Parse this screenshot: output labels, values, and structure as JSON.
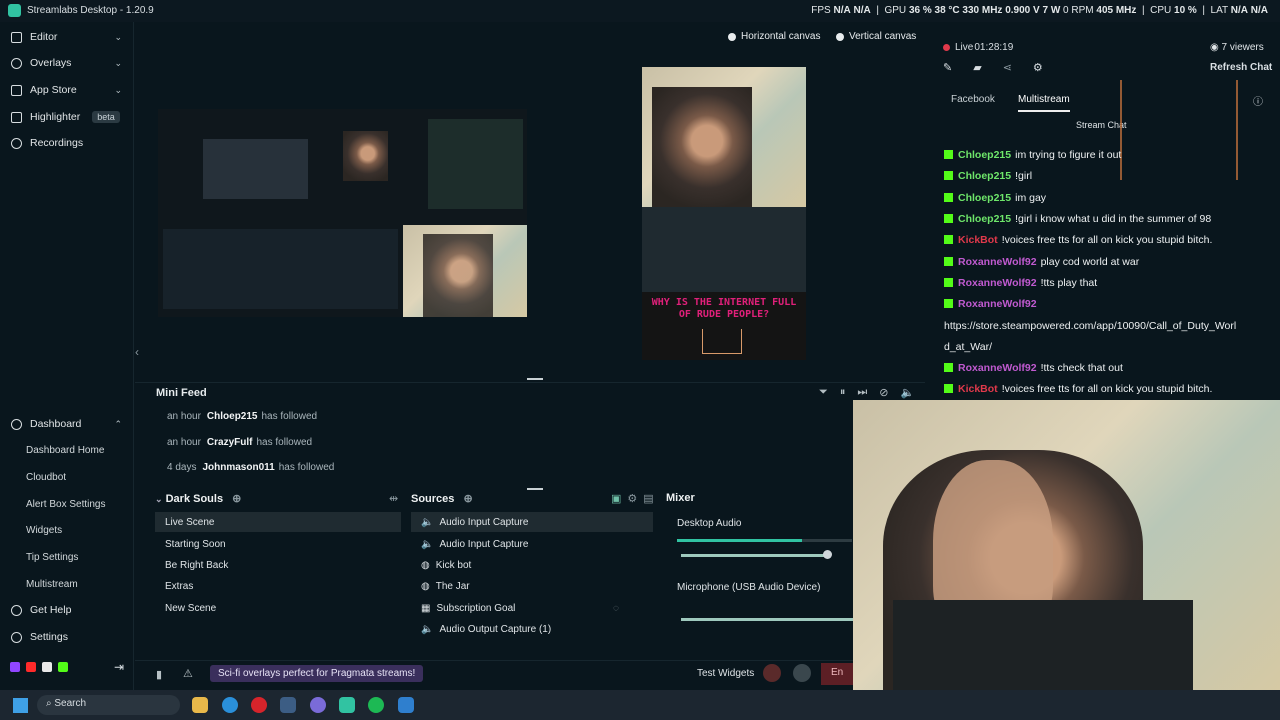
{
  "titlebar": {
    "title": "Streamlabs Desktop - 1.20.9",
    "fps_label": "FPS",
    "fps_value": "N/A",
    "fps_value2": "N/A",
    "gpu_label": "GPU",
    "gpu_usage": "36 %",
    "gpu_temp": "38 °C",
    "gpu_clock": "330 MHz",
    "gpu_volt": "0.900 V",
    "gpu_power": "7 W",
    "mem_clock_label": "0 RPM",
    "mem_clock": "405 MHz",
    "cpu_label": "CPU",
    "cpu_value": "10 %",
    "lat_label": "LAT",
    "lat_value": "N/A",
    "lat_value2": "N/A"
  },
  "sidebar": {
    "items": [
      {
        "label": "Editor",
        "icon": "editor-icon"
      },
      {
        "label": "Overlays",
        "icon": "overlays-icon"
      },
      {
        "label": "App Store",
        "icon": "app-store-icon"
      },
      {
        "label": "Highlighter",
        "icon": "highlighter-icon",
        "badge": "beta"
      },
      {
        "label": "Recordings",
        "icon": "recordings-icon"
      }
    ],
    "dashboard": {
      "label": "Dashboard",
      "sub": [
        "Dashboard Home",
        "Cloudbot",
        "Alert Box Settings",
        "Widgets",
        "Tip Settings",
        "Multistream"
      ]
    },
    "get_help": "Get Help",
    "settings": "Settings"
  },
  "canvas": {
    "horizontal": "Horizontal canvas",
    "vertical": "Vertical canvas",
    "vertical_overlay_text": "WHY IS THE INTERNET FULL OF RUDE PEOPLE?"
  },
  "mini_feed": {
    "title": "Mini Feed",
    "rows": [
      {
        "time": "an hour",
        "user": "Chloep215",
        "action": "has followed"
      },
      {
        "time": "an hour",
        "user": "CrazyFulf",
        "action": "has followed"
      },
      {
        "time": "4 days",
        "user": "Johnmason011",
        "action": "has followed"
      }
    ]
  },
  "scenes": {
    "title": "Dark Souls",
    "items": [
      "Live Scene",
      "Starting Soon",
      "Be Right Back",
      "Extras",
      "New Scene"
    ]
  },
  "sources": {
    "title": "Sources",
    "items": [
      "Audio Input Capture",
      "Audio Input Capture",
      "Kick bot",
      "The Jar",
      "Subscription Goal",
      "Audio Output Capture (1)"
    ]
  },
  "mixer": {
    "title": "Mixer",
    "channels": [
      {
        "name": "Desktop Audio",
        "level": 0.8,
        "volume": 1.0
      },
      {
        "name": "Microphone (USB Audio Device)",
        "level": 1.0,
        "volume": 1.0
      }
    ]
  },
  "footer": {
    "promo": "Sci-fi overlays perfect for Pragmata streams!",
    "test_widgets": "Test Widgets",
    "end": "En"
  },
  "chat": {
    "live_label": "Live",
    "live_time": "01:28:19",
    "viewers": "7 viewers",
    "refresh": "Refresh Chat",
    "tabs": [
      "Facebook",
      "Multistream"
    ],
    "stream_chat": "Stream Chat",
    "messages": [
      {
        "user": "Chloep215",
        "text": "im trying to figure it out",
        "color": "#6ee66a"
      },
      {
        "user": "Chloep215",
        "text": "!girl",
        "color": "#6ee66a"
      },
      {
        "user": "Chloep215",
        "text": "im gay",
        "color": "#6ee66a"
      },
      {
        "user": "Chloep215",
        "text": "!girl i know what u did in the summer of 98",
        "color": "#6ee66a"
      },
      {
        "user": "KickBot",
        "text": "!voices free tts for all on kick you stupid bitch.",
        "color": "#e0394b"
      },
      {
        "user": "RoxanneWolf92",
        "text": "play cod world at war",
        "color": "#c05ad0"
      },
      {
        "user": "RoxanneWolf92",
        "text": "!tts play that",
        "color": "#c05ad0"
      },
      {
        "user": "RoxanneWolf92",
        "text": "",
        "color": "#c05ad0"
      }
    ],
    "link_line1": "https://store.steampowered.com/app/10090/Call_of_Duty_Worl",
    "link_line2": "d_at_War/",
    "messages2": [
      {
        "user": "RoxanneWolf92",
        "text": "!tts check that out",
        "color": "#c05ad0"
      },
      {
        "user": "KickBot",
        "text": "!voices free tts for all on kick you stupid bitch.",
        "color": "#e0394b"
      }
    ]
  },
  "taskbar": {
    "search": "Search"
  }
}
